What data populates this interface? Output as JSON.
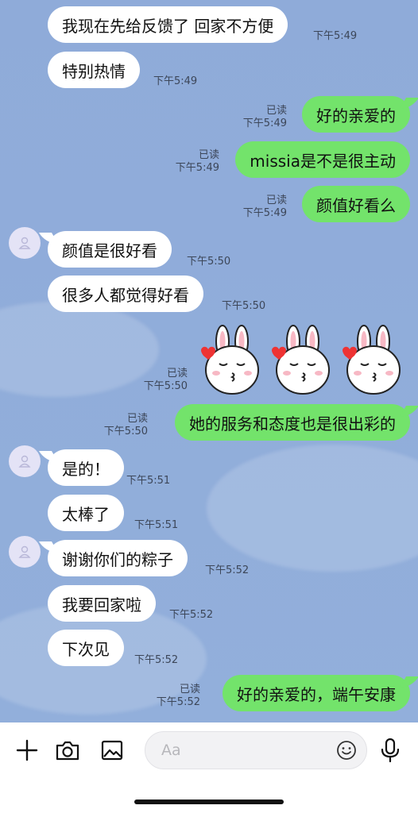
{
  "messages": [
    {
      "text": "我现在先给反馈了 回家不方便",
      "time": "下午5:49"
    },
    {
      "text": "特别热情",
      "time": "下午5:49"
    },
    {
      "text": "好的亲爱的",
      "read": "已读",
      "time": "下午5:49"
    },
    {
      "text": "missia是不是很主动",
      "read": "已读",
      "time": "下午5:49"
    },
    {
      "text": "颜值好看么",
      "read": "已读",
      "time": "下午5:49"
    },
    {
      "text": "颜值是很好看",
      "time": "下午5:50"
    },
    {
      "text": "很多人都觉得好看",
      "time": "下午5:50"
    },
    {
      "read": "已读",
      "time": "下午5:50"
    },
    {
      "text": "她的服务和态度也是很出彩的",
      "read": "已读",
      "time": "下午5:50"
    },
    {
      "text": "是的！",
      "time": "下午5:51"
    },
    {
      "text": "太棒了",
      "time": "下午5:51"
    },
    {
      "text": "谢谢你们的粽子",
      "time": "下午5:52"
    },
    {
      "text": "我要回家啦",
      "time": "下午5:52"
    },
    {
      "text": "下次见",
      "time": "下午5:52"
    },
    {
      "text": "好的亲爱的，端午安康",
      "read": "已读",
      "time": "下午5:52"
    }
  ],
  "composer": {
    "placeholder": "Aa"
  },
  "icons": {
    "add": "plus-icon",
    "camera": "camera-icon",
    "gallery": "image-icon",
    "emoji": "smiley-icon",
    "mic": "microphone-icon",
    "avatar": "person-icon",
    "sticker": "bunny-sticker"
  },
  "colors": {
    "background": "#8eabd8",
    "outgoing": "#73e36b",
    "incoming": "#ffffff"
  }
}
